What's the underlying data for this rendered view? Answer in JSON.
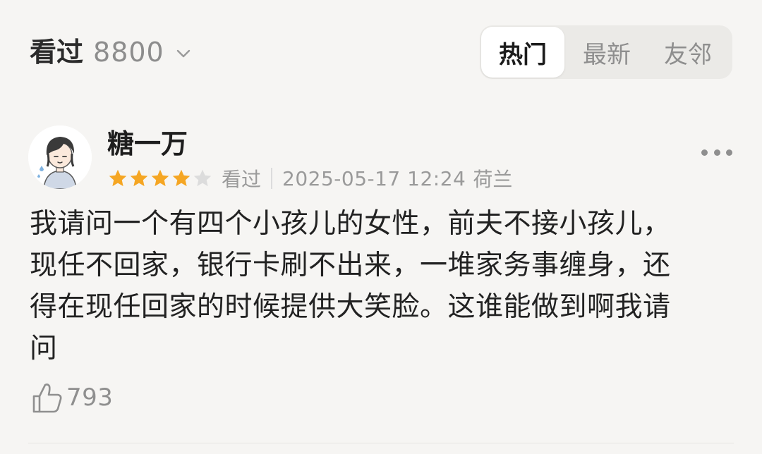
{
  "header": {
    "filter_label": "看过",
    "filter_count": "8800"
  },
  "tabs": [
    {
      "label": "热门",
      "active": true
    },
    {
      "label": "最新",
      "active": false
    },
    {
      "label": "友邻",
      "active": false
    }
  ],
  "review": {
    "username": "糖一万",
    "rating": 4,
    "rating_max": 5,
    "status": "看过",
    "date": "2025-05-17 12:24",
    "location": "荷兰",
    "lines": [
      "我请问一个有四个小孩儿的女性，前夫不接小孩儿，",
      "现任不回家，银行卡刷不出来，一堆家务事缠身，还",
      "得在现任回家的时候提供大笑脸。这谁能做到啊我请",
      "问"
    ],
    "likes": "793"
  },
  "colors": {
    "star_filled": "#f5a623",
    "star_empty": "#dcdcdc",
    "background": "#f6f5f3"
  },
  "icons": {
    "chevron": "chevron-down-icon",
    "more": "more-icon",
    "like": "thumbs-up-icon"
  }
}
